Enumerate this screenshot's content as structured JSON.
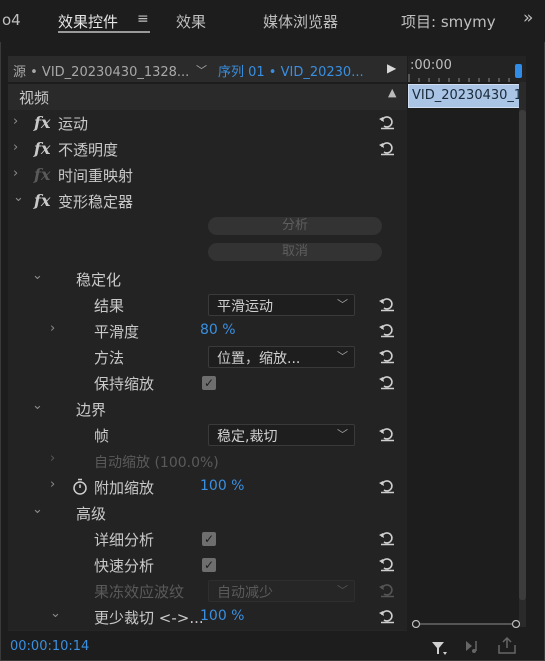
{
  "tabs": [
    {
      "label": "o4"
    },
    {
      "label": "效果控件"
    },
    {
      "label": "效果"
    },
    {
      "label": "媒体浏览器"
    },
    {
      "label": "项目: smymy"
    }
  ],
  "tab_menu_icon": "≡",
  "overflow_icon": "»",
  "source": {
    "clip_label": "源 • VID_20230430_1328...",
    "sequence_label": "序列 01 • VID_20230...",
    "play_icon": "▶"
  },
  "timeline": {
    "timecode_header": ":00:00",
    "clip_name": "VID_20230430_1"
  },
  "section_video": "视频",
  "effects": [
    {
      "name": "运动",
      "icon": "fx"
    },
    {
      "name": "不透明度",
      "icon": "fx"
    },
    {
      "name": "时间重映射",
      "icon": "fx"
    },
    {
      "name": "变形稳定器",
      "icon": "fx"
    }
  ],
  "buttons": {
    "analyze": "分析",
    "cancel": "取消"
  },
  "stabilization": {
    "group": "稳定化",
    "result_label": "结果",
    "result_value": "平滑运动",
    "smoothness_label": "平滑度",
    "smoothness_value": "80 %",
    "method_label": "方法",
    "method_value": "位置，缩放...",
    "keep_scale_label": "保持缩放",
    "keep_scale_checked": true
  },
  "borders": {
    "group": "边界",
    "framing_label": "帧",
    "framing_value": "稳定,裁切",
    "auto_scale_label": "自动缩放 (100.0%)",
    "additional_scale_label": "附加缩放",
    "additional_scale_value": "100 %"
  },
  "advanced": {
    "group": "高级",
    "detailed_label": "详细分析",
    "detailed_checked": true,
    "fast_label": "快速分析",
    "fast_checked": true,
    "rolling_label": "果冻效应波纹",
    "rolling_value": "自动减少",
    "crop_less_label": "更少裁切 <->...",
    "crop_less_value": "100 %"
  },
  "status": {
    "timecode": "00:00:10:14"
  },
  "colors": {
    "accent": "#3a8fe0",
    "panel_bg": "#1d1d1d",
    "clip": "#a9c4e4"
  }
}
